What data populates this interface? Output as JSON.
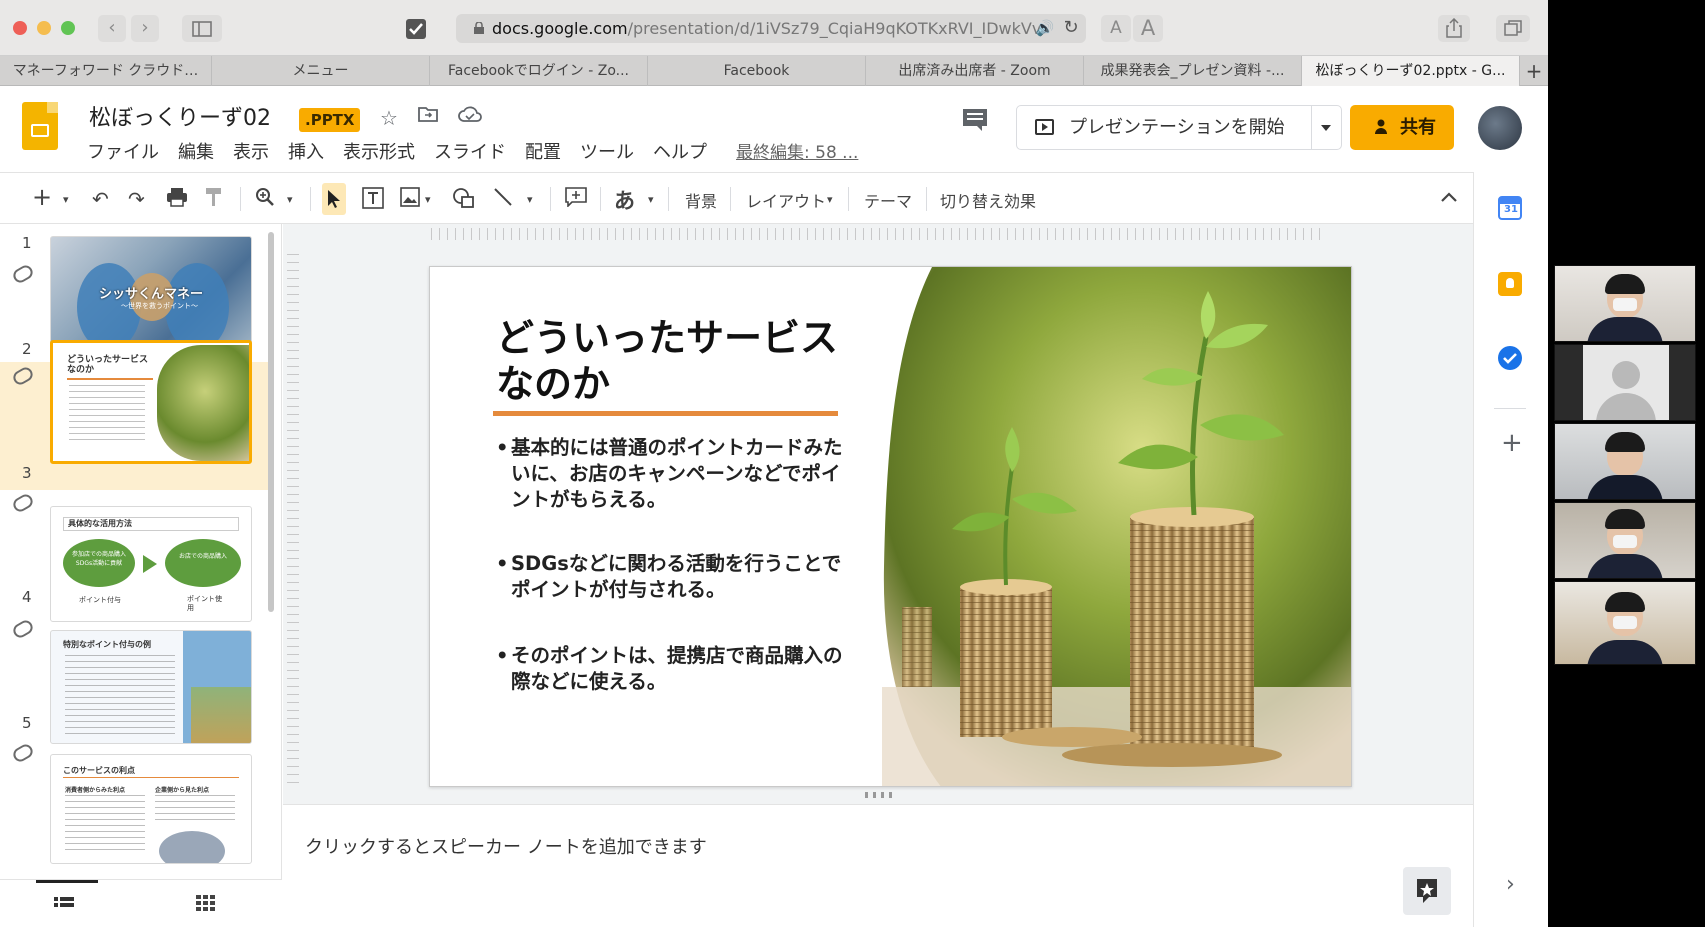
{
  "browser": {
    "url_host": "docs.google.com",
    "url_path": "/presentation/d/1iVSz79_CqiaH9qKOTKxRVI_IDwkVv",
    "font_small": "A",
    "font_large": "A",
    "tabs": [
      {
        "label": "マネーフォワード クラウド…"
      },
      {
        "label": "メニュー"
      },
      {
        "label": "Facebookでログイン - Zo..."
      },
      {
        "label": "Facebook"
      },
      {
        "label": "出席済み出席者 - Zoom"
      },
      {
        "label": "成果発表会_プレゼン資料 -..."
      },
      {
        "label": "松ぼっくりーず02.pptx - G..."
      }
    ],
    "new_tab_label": "+"
  },
  "app": {
    "doc_title": "松ぼっくりーず02",
    "file_badge": ".PPTX",
    "menus": [
      "ファイル",
      "編集",
      "表示",
      "挿入",
      "表示形式",
      "スライド",
      "配置",
      "ツール",
      "ヘルプ"
    ],
    "last_edit": "最終編集: 58 ...",
    "present_label": "プレゼンテーションを開始",
    "share_label": "共有",
    "accent_color": "#f9ab00"
  },
  "toolbar": {
    "ime_label": "あ",
    "background_label": "背景",
    "layout_label": "レイアウト",
    "theme_label": "テーマ",
    "transition_label": "切り替え効果"
  },
  "filmstrip": {
    "slides": [
      {
        "num": "1",
        "title": "シッサくんマネー",
        "subtitle": "～世界を救うポイント～"
      },
      {
        "num": "2",
        "title": "どういったサービスなのか"
      },
      {
        "num": "3",
        "title": "具体的な活用方法",
        "left_circle": "参加店での商品購入",
        "left_circle_sub": "SDGs活動に貢献",
        "right_circle": "お店での商品購入",
        "left_caption": "ポイント付与",
        "right_caption": "ポイント使用"
      },
      {
        "num": "4",
        "title": "特別なポイント付与の例"
      },
      {
        "num": "5",
        "title": "このサービスの利点",
        "col_left": "消費者側からみた利点",
        "col_right": "企業側から見た利点"
      }
    ],
    "selected_index": 1
  },
  "slide": {
    "title": "どういったサービスなのか",
    "bullets": [
      "基本的には普通のポイントカードみたいに、お店のキャンペーンなどでポイントがもらえる。",
      "SDGsなどに関わる活動を行うことでポイントが付与される。",
      "そのポイントは、提携店で商品購入の際などに使える。"
    ],
    "rule_color": "#e58a3c"
  },
  "notes": {
    "placeholder": "クリックするとスピーカー ノートを追加できます"
  }
}
